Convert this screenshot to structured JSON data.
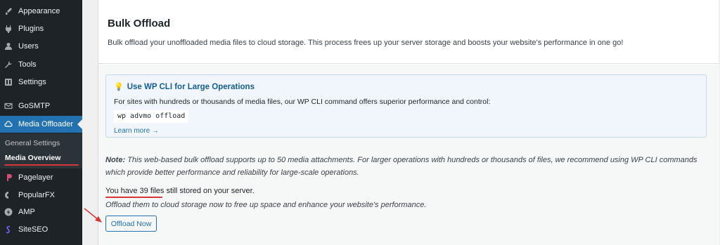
{
  "sidebar": {
    "items": [
      {
        "label": "Appearance",
        "icon": "paintbrush-icon"
      },
      {
        "label": "Plugins",
        "icon": "plugins-icon"
      },
      {
        "label": "Users",
        "icon": "users-icon"
      },
      {
        "label": "Tools",
        "icon": "tools-icon"
      },
      {
        "label": "Settings",
        "icon": "settings-icon"
      },
      {
        "label": "GoSMTP",
        "icon": "mail-icon"
      },
      {
        "label": "Media Offloader",
        "icon": "cloud-icon"
      },
      {
        "label": "Pagelayer",
        "icon": "pagelayer-icon"
      },
      {
        "label": "PopularFX",
        "icon": "popularfx-icon"
      },
      {
        "label": "AMP",
        "icon": "amp-icon"
      },
      {
        "label": "SiteSEO",
        "icon": "siteseo-icon"
      }
    ],
    "submenu": {
      "general_settings": "General Settings",
      "media_overview": "Media Overview"
    }
  },
  "page": {
    "title": "Bulk Offload",
    "description": "Bulk offload your unoffloaded media files to cloud storage. This process frees up your server storage and boosts your website's performance in one go!"
  },
  "cli_box": {
    "title": "Use WP CLI for Large Operations",
    "description": "For sites with hundreds or thousands of media files, our WP CLI command offers superior performance and control:",
    "command": "wp advmo offload",
    "learn_more": "Learn more →"
  },
  "note": {
    "label": "Note:",
    "text": "This web-based bulk offload supports up to 50 media attachments. For larger operations with hundreds or thousands of files, we recommend using WP CLI commands which provide better performance and reliability for large-scale operations."
  },
  "status": {
    "files_highlight": "You have 39 files",
    "files_rest": "still stored on your server.",
    "hint": "Offload them to cloud storage now to free up space and enhance your website's performance."
  },
  "actions": {
    "offload_now": "Offload Now"
  },
  "colors": {
    "sidebar_bg": "#1d2327",
    "active_blue": "#2271b1",
    "annotation_red": "#d63638"
  }
}
